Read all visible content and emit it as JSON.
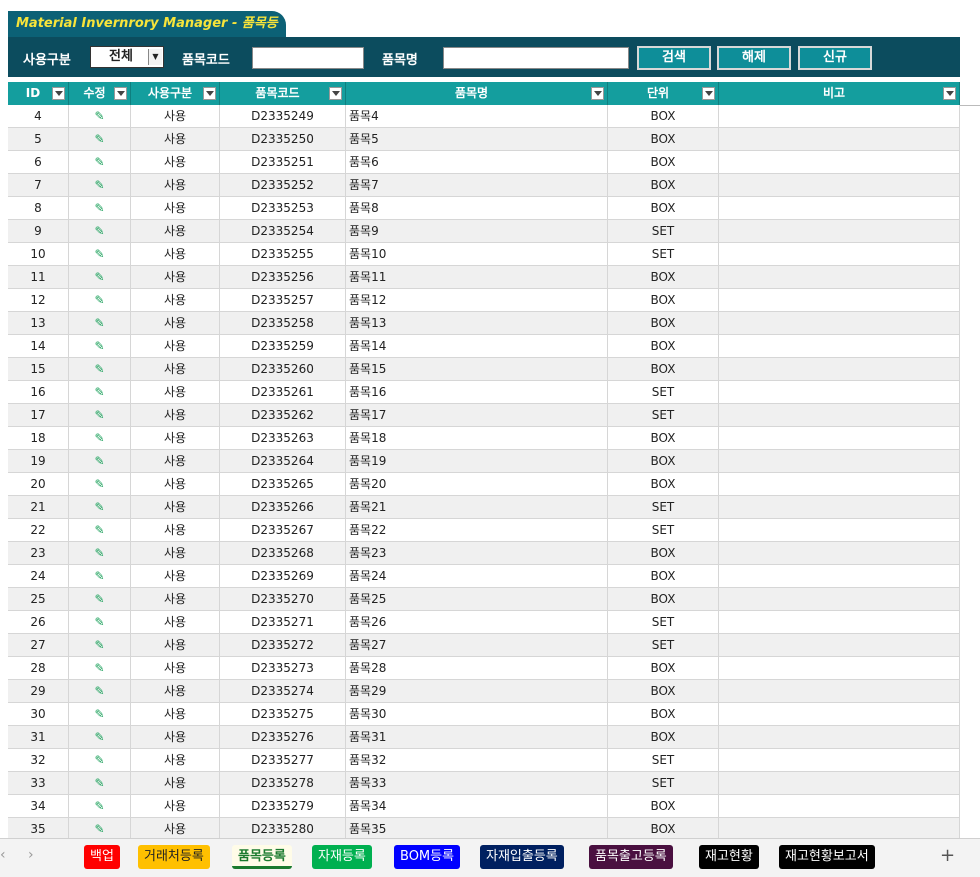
{
  "title": "Material Invernrory Manager - 품목등록",
  "toolbar": {
    "usage_label": "사용구분",
    "usage_value": "전체",
    "code_label": "품목코드",
    "name_label": "품목명",
    "search_button": "검색",
    "clear_button": "해제",
    "new_button": "신규"
  },
  "table": {
    "headers": [
      "ID",
      "수정",
      "사용구분",
      "품목코드",
      "품목명",
      "단위",
      "비고"
    ],
    "rows": [
      {
        "id": "4",
        "use": "사용",
        "code": "D2335249",
        "name": "품목4",
        "unit": "BOX"
      },
      {
        "id": "5",
        "use": "사용",
        "code": "D2335250",
        "name": "품목5",
        "unit": "BOX"
      },
      {
        "id": "6",
        "use": "사용",
        "code": "D2335251",
        "name": "품목6",
        "unit": "BOX"
      },
      {
        "id": "7",
        "use": "사용",
        "code": "D2335252",
        "name": "품목7",
        "unit": "BOX"
      },
      {
        "id": "8",
        "use": "사용",
        "code": "D2335253",
        "name": "품목8",
        "unit": "BOX"
      },
      {
        "id": "9",
        "use": "사용",
        "code": "D2335254",
        "name": "품목9",
        "unit": "SET"
      },
      {
        "id": "10",
        "use": "사용",
        "code": "D2335255",
        "name": "품목10",
        "unit": "SET"
      },
      {
        "id": "11",
        "use": "사용",
        "code": "D2335256",
        "name": "품목11",
        "unit": "BOX"
      },
      {
        "id": "12",
        "use": "사용",
        "code": "D2335257",
        "name": "품목12",
        "unit": "BOX"
      },
      {
        "id": "13",
        "use": "사용",
        "code": "D2335258",
        "name": "품목13",
        "unit": "BOX"
      },
      {
        "id": "14",
        "use": "사용",
        "code": "D2335259",
        "name": "품목14",
        "unit": "BOX"
      },
      {
        "id": "15",
        "use": "사용",
        "code": "D2335260",
        "name": "품목15",
        "unit": "BOX"
      },
      {
        "id": "16",
        "use": "사용",
        "code": "D2335261",
        "name": "품목16",
        "unit": "SET"
      },
      {
        "id": "17",
        "use": "사용",
        "code": "D2335262",
        "name": "품목17",
        "unit": "SET"
      },
      {
        "id": "18",
        "use": "사용",
        "code": "D2335263",
        "name": "품목18",
        "unit": "BOX"
      },
      {
        "id": "19",
        "use": "사용",
        "code": "D2335264",
        "name": "품목19",
        "unit": "BOX"
      },
      {
        "id": "20",
        "use": "사용",
        "code": "D2335265",
        "name": "품목20",
        "unit": "BOX"
      },
      {
        "id": "21",
        "use": "사용",
        "code": "D2335266",
        "name": "품목21",
        "unit": "SET"
      },
      {
        "id": "22",
        "use": "사용",
        "code": "D2335267",
        "name": "품목22",
        "unit": "SET"
      },
      {
        "id": "23",
        "use": "사용",
        "code": "D2335268",
        "name": "품목23",
        "unit": "BOX"
      },
      {
        "id": "24",
        "use": "사용",
        "code": "D2335269",
        "name": "품목24",
        "unit": "BOX"
      },
      {
        "id": "25",
        "use": "사용",
        "code": "D2335270",
        "name": "품목25",
        "unit": "BOX"
      },
      {
        "id": "26",
        "use": "사용",
        "code": "D2335271",
        "name": "품목26",
        "unit": "SET"
      },
      {
        "id": "27",
        "use": "사용",
        "code": "D2335272",
        "name": "품목27",
        "unit": "SET"
      },
      {
        "id": "28",
        "use": "사용",
        "code": "D2335273",
        "name": "품목28",
        "unit": "BOX"
      },
      {
        "id": "29",
        "use": "사용",
        "code": "D2335274",
        "name": "품목29",
        "unit": "BOX"
      },
      {
        "id": "30",
        "use": "사용",
        "code": "D2335275",
        "name": "품목30",
        "unit": "BOX"
      },
      {
        "id": "31",
        "use": "사용",
        "code": "D2335276",
        "name": "품목31",
        "unit": "BOX"
      },
      {
        "id": "32",
        "use": "사용",
        "code": "D2335277",
        "name": "품목32",
        "unit": "SET"
      },
      {
        "id": "33",
        "use": "사용",
        "code": "D2335278",
        "name": "품목33",
        "unit": "SET"
      },
      {
        "id": "34",
        "use": "사용",
        "code": "D2335279",
        "name": "품목34",
        "unit": "BOX"
      },
      {
        "id": "35",
        "use": "사용",
        "code": "D2335280",
        "name": "품목35",
        "unit": "BOX"
      }
    ]
  },
  "sheet_tabs": [
    {
      "label": "백업",
      "bg": "#ff0000",
      "fg": "#ffffff"
    },
    {
      "label": "거래처등록",
      "bg": "#ffc000",
      "fg": "#222222"
    },
    {
      "label": "품목등록",
      "bg": "#fffce8",
      "fg": "#1a7a2e",
      "active": true
    },
    {
      "label": "자재등록",
      "bg": "#00b050",
      "fg": "#ffffff"
    },
    {
      "label": "BOM등록",
      "bg": "#0000ff",
      "fg": "#ffffff"
    },
    {
      "label": "자재입출등록",
      "bg": "#002060",
      "fg": "#ffffff"
    },
    {
      "label": "품목출고등록",
      "bg": "#4a1040",
      "fg": "#ffffff"
    },
    {
      "label": "재고현황",
      "bg": "#000000",
      "fg": "#ffffff"
    },
    {
      "label": "재고현황보고서",
      "bg": "#000000",
      "fg": "#ffffff"
    }
  ],
  "icons": {
    "edit": "pencil-icon",
    "filter": "dropdown-filter-icon",
    "add_sheet": "+"
  },
  "colors": {
    "header_teal": "#149e9e",
    "toolbar_navy": "#0c4c5e",
    "title_yellow": "#f7e43a"
  }
}
